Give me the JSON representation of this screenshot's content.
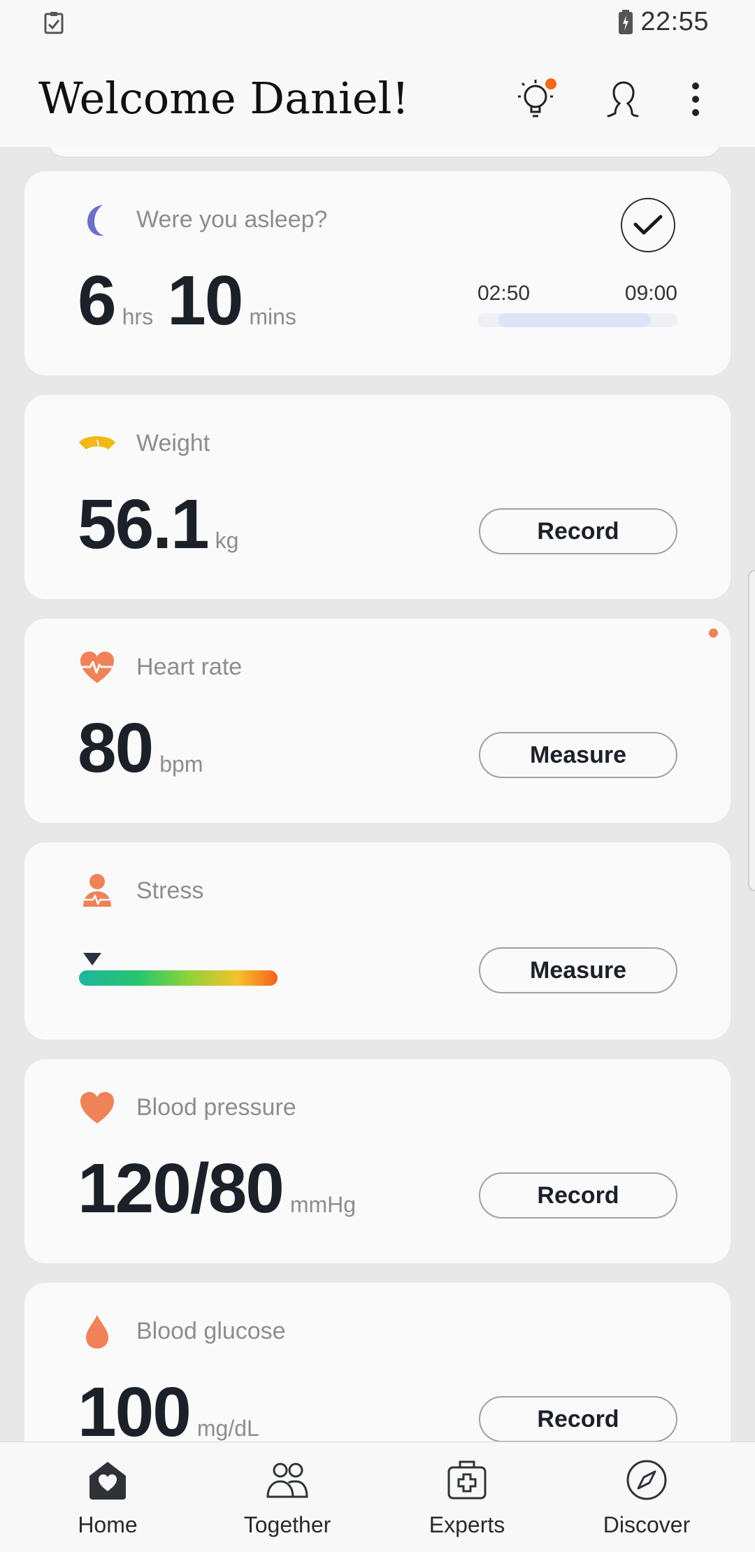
{
  "status_bar": {
    "time": "22:55"
  },
  "header": {
    "title": "Welcome Daniel!"
  },
  "cards": {
    "sleep": {
      "label": "Were you asleep?",
      "hours": "6",
      "hours_unit": "hrs",
      "minutes": "10",
      "minutes_unit": "mins",
      "start": "02:50",
      "end": "09:00"
    },
    "weight": {
      "label": "Weight",
      "value": "56.1",
      "unit": "kg",
      "button": "Record"
    },
    "heart_rate": {
      "label": "Heart rate",
      "value": "80",
      "unit": "bpm",
      "button": "Measure"
    },
    "stress": {
      "label": "Stress",
      "button": "Measure"
    },
    "blood_pressure": {
      "label": "Blood pressure",
      "value": "120/80",
      "unit": "mmHg",
      "button": "Record"
    },
    "blood_glucose": {
      "label": "Blood glucose",
      "value": "100",
      "unit": "mg/dL",
      "button": "Record"
    }
  },
  "bottom_nav": {
    "items": [
      {
        "label": "Home",
        "icon": "home-heart-icon"
      },
      {
        "label": "Together",
        "icon": "people-icon"
      },
      {
        "label": "Experts",
        "icon": "medical-kit-icon"
      },
      {
        "label": "Discover",
        "icon": "compass-icon"
      }
    ]
  },
  "colors": {
    "accent_orange": "#f06a1a",
    "sleep_moon": "#6a6fc8",
    "weight_yellow": "#f2b817",
    "heart_coral": "#f0825a"
  }
}
